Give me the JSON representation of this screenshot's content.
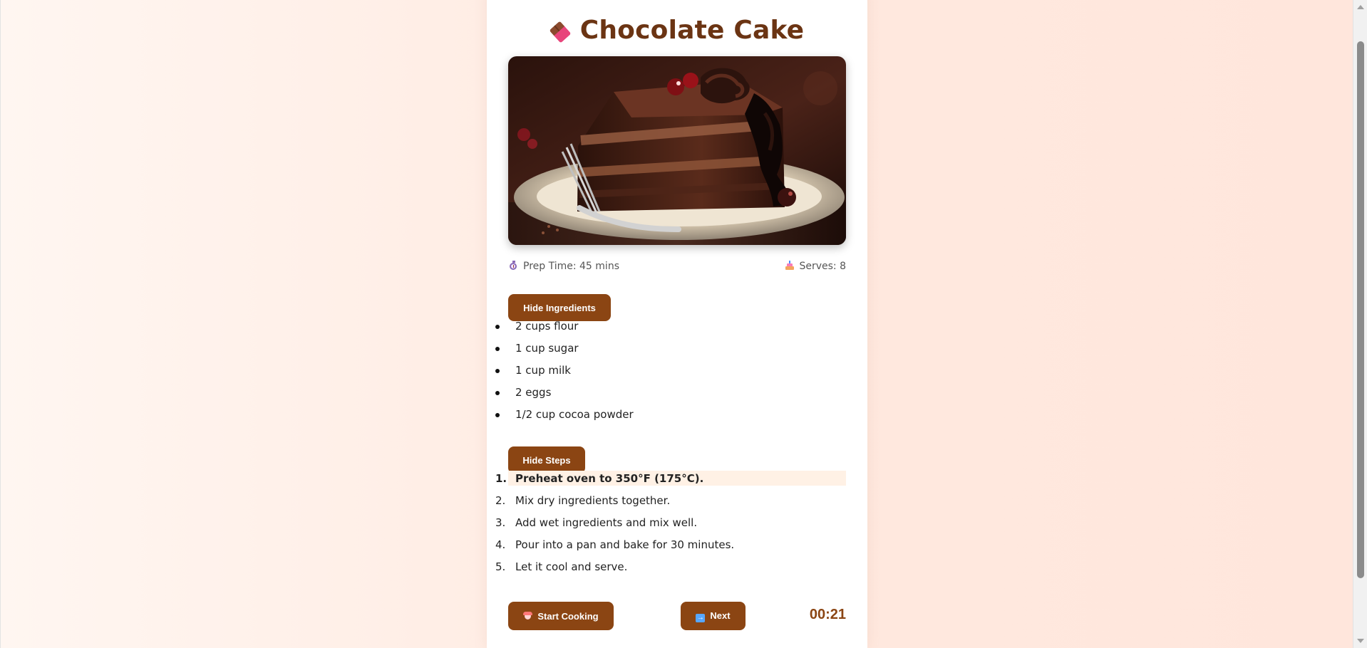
{
  "recipe": {
    "title": "Chocolate Cake",
    "title_icon": "chocolate-bar-icon",
    "image_alt": "Slice of chocolate cake with fork on a plate",
    "prep_time": "Prep Time: 45 mins",
    "prep_icon": "stopwatch-icon",
    "serves": "Serves: 8",
    "serves_icon": "cake-icon"
  },
  "ingredients": {
    "toggle_label": "Hide Ingredients",
    "items": [
      "2 cups flour",
      "1 cup sugar",
      "1 cup milk",
      "2 eggs",
      "1/2 cup cocoa powder"
    ]
  },
  "steps": {
    "toggle_label": "Hide Steps",
    "active_index": 0,
    "items": [
      {
        "number": "1.",
        "text": "Preheat oven to 350°F (175°C)."
      },
      {
        "number": "2.",
        "text": "Mix dry ingredients together."
      },
      {
        "number": "3.",
        "text": "Add wet ingredients and mix well."
      },
      {
        "number": "4.",
        "text": "Pour into a pan and bake for 30 minutes."
      },
      {
        "number": "5.",
        "text": "Let it cool and serve."
      }
    ]
  },
  "controls": {
    "start_label": "Start Cooking",
    "start_icon": "chef-icon",
    "next_label": "Next",
    "next_icon": "right-arrow-icon",
    "timer": "00:21"
  },
  "colors": {
    "accent": "#8b4513",
    "title": "#6b3413",
    "active_step_bg": "#fff1e5",
    "page_bg": "#ffe9df"
  }
}
